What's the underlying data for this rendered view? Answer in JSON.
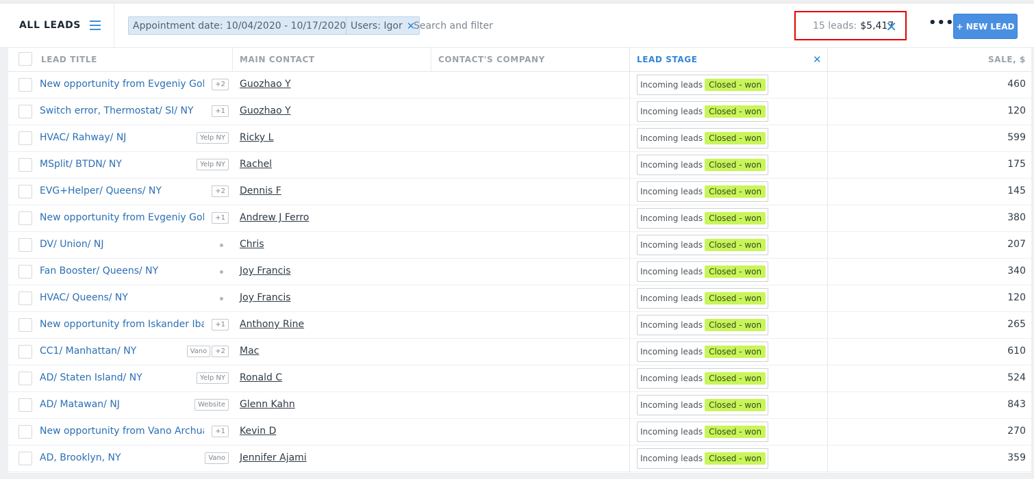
{
  "header": {
    "title": "ALL LEADS",
    "filters": [
      {
        "label": "Appointment date: 10/04/2020 - 10/17/2020"
      },
      {
        "label": "Users: Igor"
      }
    ],
    "search_placeholder": "Search and filter",
    "summary": {
      "count": "15 leads:",
      "amount": "$5,417"
    },
    "more_label": "•••",
    "new_lead_label": "+ NEW LEAD"
  },
  "columns": {
    "lead_title": "LEAD TITLE",
    "main_contact": "MAIN CONTACT",
    "company": "CONTACT'S COMPANY",
    "lead_stage": "LEAD STAGE",
    "sale": "SALE, $"
  },
  "colors": {
    "accent": "#4a90e2",
    "status_won": "#c8f55a",
    "highlight_box": "#e30000"
  },
  "rows": [
    {
      "title": "New opportunity from Evgeniy Golom",
      "tags": [
        "+2"
      ],
      "contact": "Guozhao Y",
      "pipeline": "Incoming leads",
      "status": "Closed - won",
      "sale": "460"
    },
    {
      "title": "Switch error, Thermostat/ SI/ NY",
      "tags": [
        "+1"
      ],
      "contact": "Guozhao Y",
      "pipeline": "Incoming leads",
      "status": "Closed - won",
      "sale": "120"
    },
    {
      "title": "HVAC/ Rahway/ NJ",
      "tags": [
        "Yelp NY"
      ],
      "contact": "Ricky L",
      "pipeline": "Incoming leads",
      "status": "Closed - won",
      "sale": "599"
    },
    {
      "title": "MSplit/ BTDN/ NY",
      "tags": [
        "Yelp NY"
      ],
      "contact": "Rachel",
      "pipeline": "Incoming leads",
      "status": "Closed - won",
      "sale": "175"
    },
    {
      "title": "EVG+Helper/ Queens/ NY",
      "tags": [
        "+2"
      ],
      "contact": "Dennis F",
      "pipeline": "Incoming leads",
      "status": "Closed - won",
      "sale": "145"
    },
    {
      "title": "New opportunity from Evgeniy Golom",
      "tags": [
        "+1"
      ],
      "contact": "Andrew J Ferro",
      "pipeline": "Incoming leads",
      "status": "Closed - won",
      "sale": "380"
    },
    {
      "title": "DV/ Union/ NJ",
      "tags": [],
      "contact": "Chris",
      "pipeline": "Incoming leads",
      "status": "Closed - won",
      "sale": "207"
    },
    {
      "title": "Fan Booster/ Queens/ NY",
      "tags": [],
      "contact": "Joy Francis",
      "pipeline": "Incoming leads",
      "status": "Closed - won",
      "sale": "340"
    },
    {
      "title": "HVAC/ Queens/ NY",
      "tags": [],
      "contact": "Joy Francis",
      "pipeline": "Incoming leads",
      "status": "Closed - won",
      "sale": "120"
    },
    {
      "title": "New opportunity from Iskander Ibado",
      "tags": [
        "+1"
      ],
      "contact": "Anthony Rine",
      "pipeline": "Incoming leads",
      "status": "Closed - won",
      "sale": "265"
    },
    {
      "title": "CC1/ Manhattan/ NY",
      "tags": [
        "Vano",
        "+2"
      ],
      "contact": "Mac",
      "pipeline": "Incoming leads",
      "status": "Closed - won",
      "sale": "610"
    },
    {
      "title": "AD/ Staten Island/ NY",
      "tags": [
        "Yelp NY"
      ],
      "contact": "Ronald C",
      "pipeline": "Incoming leads",
      "status": "Closed - won",
      "sale": "524"
    },
    {
      "title": "AD/ Matawan/ NJ",
      "tags": [
        "Website"
      ],
      "contact": "Glenn Kahn",
      "pipeline": "Incoming leads",
      "status": "Closed - won",
      "sale": "843"
    },
    {
      "title": "New opportunity from Vano Archuash",
      "tags": [
        "+1"
      ],
      "contact": "Kevin D",
      "pipeline": "Incoming leads",
      "status": "Closed - won",
      "sale": "270"
    },
    {
      "title": "AD, Brooklyn, NY",
      "tags": [
        "Vano"
      ],
      "contact": "Jennifer Ajami",
      "pipeline": "Incoming leads",
      "status": "Closed - won",
      "sale": "359"
    }
  ]
}
